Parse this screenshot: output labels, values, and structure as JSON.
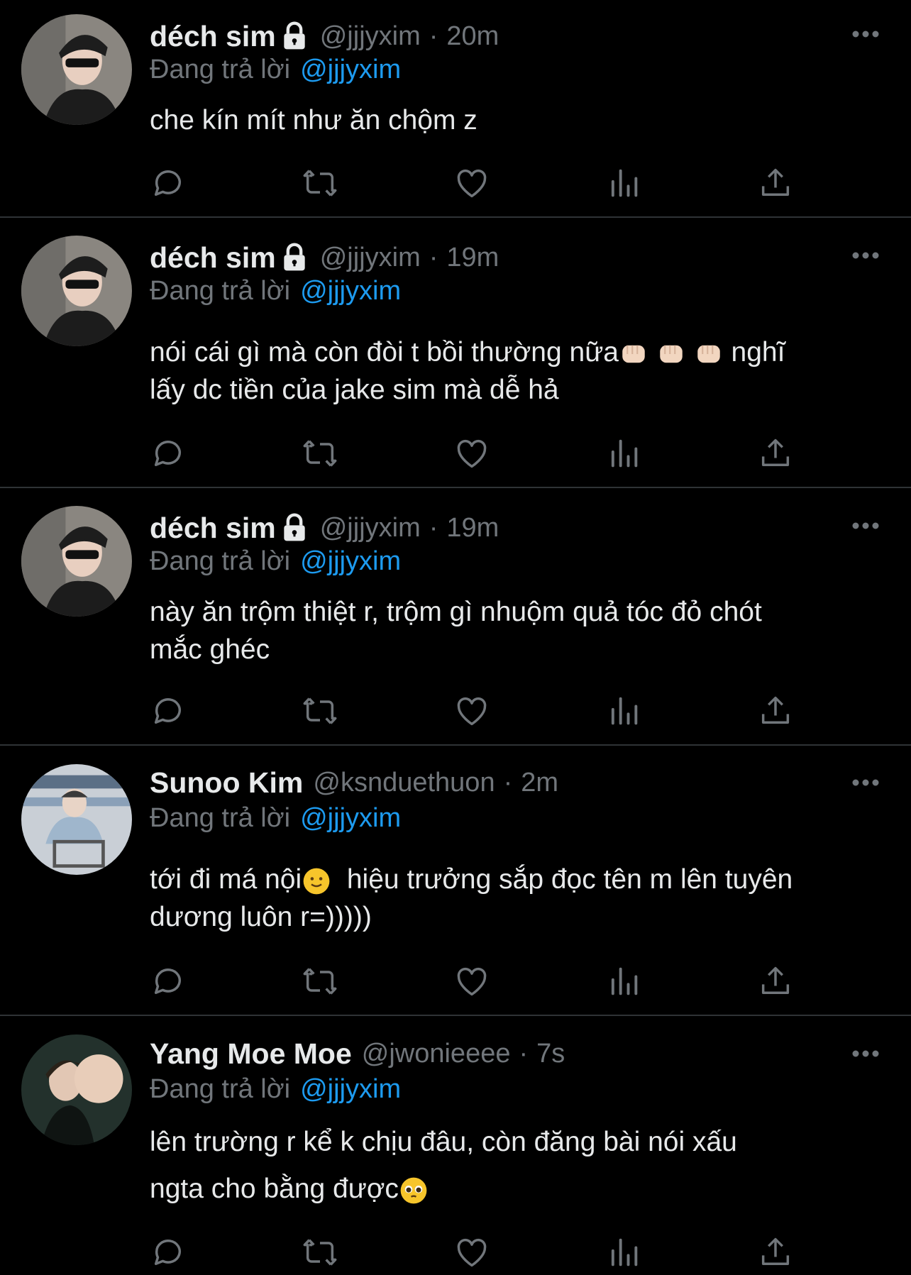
{
  "colors": {
    "background": "#000000",
    "text": "#e7e9ea",
    "muted": "#71767b",
    "accent": "#1d9bf0",
    "divider": "#2f3336"
  },
  "reply_prefix": "Đang trả lời",
  "tweets": [
    {
      "name": "déch sim",
      "locked": true,
      "handle": "@jjjyxim",
      "dot": "·",
      "time": "20m",
      "reply_to": "@jjjyxim",
      "text": "che kín mít như ăn chộm z",
      "emojis": []
    },
    {
      "name": "déch sim",
      "locked": true,
      "handle": "@jjjyxim",
      "dot": "·",
      "time": "19m",
      "reply_to": "@jjjyxim",
      "text_parts": [
        "nói cái gì mà còn đòi t bồi thường nữa",
        " ",
        " ",
        " nghĩ\nlấy dc tiền của jake sim mà dễ hả"
      ],
      "emojis": [
        "fist",
        "fist",
        "fist"
      ]
    },
    {
      "name": "déch sim",
      "locked": true,
      "handle": "@jjjyxim",
      "dot": "·",
      "time": "19m",
      "reply_to": "@jjjyxim",
      "text": "này ăn trộm thiệt r, trộm gì nhuộm quả tóc đỏ chót\nmắc ghéc",
      "emojis": []
    },
    {
      "name": "Sunoo Kim",
      "locked": false,
      "handle": "@ksnduethuon",
      "dot": "·",
      "time": "2m",
      "reply_to": "@jjjyxim",
      "text_parts": [
        "tới đi má nội",
        "  hiệu trưởng sắp đọc tên m lên tuyên\ndương luôn r=)))))"
      ],
      "emojis": [
        "slight-smile"
      ]
    },
    {
      "name": "Yang Moe Moe",
      "locked": false,
      "handle": "@jwonieeee",
      "dot": "·",
      "time": "7s",
      "reply_to": "@jjjyxim",
      "text_parts": [
        "lên trường r kể k chịu đâu, còn đăng bài nói xấu\nngta cho bằng được",
        ""
      ],
      "emojis": [
        "pleading-face"
      ]
    }
  ],
  "action_icons": [
    "reply-icon",
    "retweet-icon",
    "like-icon",
    "views-icon",
    "share-icon"
  ]
}
